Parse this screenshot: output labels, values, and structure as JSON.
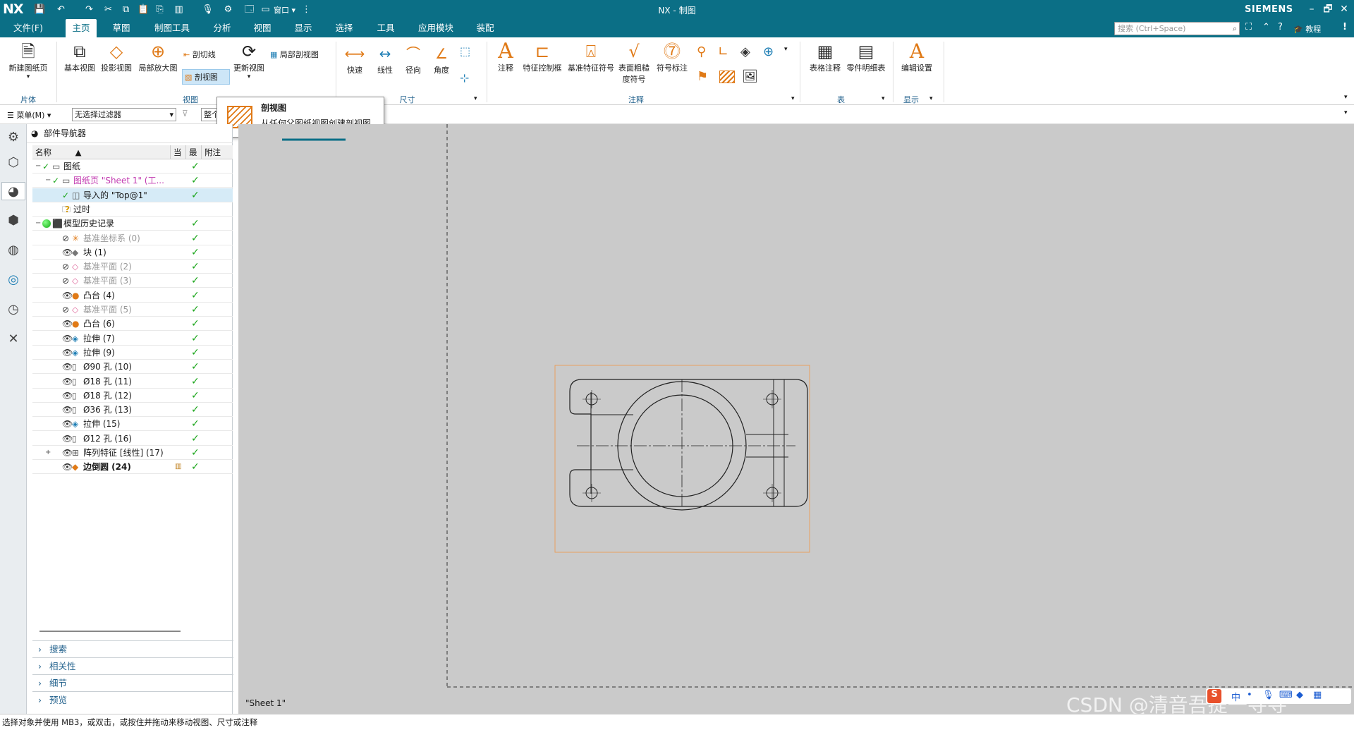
{
  "titlebar": {
    "logo": "NX",
    "title": "NX - 制图",
    "brand": "SIEMENS",
    "window_label": "窗口",
    "window_arrow": "▾",
    "minimize": "–",
    "restore": "🗗",
    "close": "✕"
  },
  "menubar": {
    "file": "文件(F)",
    "tabs": [
      "主页",
      "草图",
      "制图工具",
      "分析",
      "视图",
      "显示",
      "选择",
      "工具",
      "应用模块",
      "装配"
    ],
    "active_tab": "主页",
    "search_placeholder": "搜索 (Ctrl+Space)",
    "tutorial": "教程",
    "info": "!"
  },
  "ribbon": {
    "new_sheet": "新建图纸页",
    "base_view": "基本视图",
    "projected_view": "投影视图",
    "detail_view": "局部放大图",
    "section_line": "剖切线",
    "section_view": "剖视图",
    "update_view": "更新视图",
    "break_out": "局部剖视图",
    "rapid": "快速",
    "linear": "线性",
    "radial": "径向",
    "angular": "角度",
    "note": "注释",
    "fcf": "特征控制框",
    "datum_symbol": "基准特征符号",
    "surface_finish_1": "表面粗糙",
    "surface_finish_2": "度符号",
    "id_symbol": "符号标注",
    "tabular_note": "表格注释",
    "parts_list": "零件明细表",
    "edit_settings": "编辑设置",
    "group_sheet": "片体",
    "group_view": "视图",
    "group_dim": "尺寸",
    "group_annot": "注释",
    "group_table": "表",
    "group_display": "显示"
  },
  "tooltip": {
    "title": "剖视图",
    "desc": "从任何父图纸视图创建剖视图。"
  },
  "toolbar2": {
    "menu": "菜单(M)",
    "filter": "无选择过滤器",
    "scope": "整个"
  },
  "navigator": {
    "title": "部件导航器",
    "col_name": "名称",
    "col_current": "当",
    "col_latest": "最",
    "col_comment": "附注",
    "rows": [
      {
        "label": "图纸",
        "indent": 0
      },
      {
        "label": "图纸页 \"Sheet 1\" (工...",
        "indent": 1
      },
      {
        "label": "导入的 \"Top@1\"",
        "indent": 2
      },
      {
        "label": "过时",
        "indent": 1
      },
      {
        "label": "模型历史记录",
        "indent": 0
      },
      {
        "label": "基准坐标系 (0)",
        "indent": 1
      },
      {
        "label": "块 (1)",
        "indent": 1
      },
      {
        "label": "基准平面 (2)",
        "indent": 1
      },
      {
        "label": "基准平面 (3)",
        "indent": 1
      },
      {
        "label": "凸台 (4)",
        "indent": 1
      },
      {
        "label": "基准平面 (5)",
        "indent": 1
      },
      {
        "label": "凸台 (6)",
        "indent": 1
      },
      {
        "label": "拉伸 (7)",
        "indent": 1
      },
      {
        "label": "拉伸 (9)",
        "indent": 1
      },
      {
        "label": "Ø90 孔 (10)",
        "indent": 1
      },
      {
        "label": "Ø18 孔 (11)",
        "indent": 1
      },
      {
        "label": "Ø18 孔 (12)",
        "indent": 1
      },
      {
        "label": "Ø36 孔 (13)",
        "indent": 1
      },
      {
        "label": "拉伸 (15)",
        "indent": 1
      },
      {
        "label": "Ø12 孔 (16)",
        "indent": 1
      },
      {
        "label": "阵列特征 [线性] (17)",
        "indent": 1
      },
      {
        "label": "边倒圆 (24)",
        "indent": 1
      }
    ],
    "accordion": [
      "搜索",
      "相关性",
      "细节",
      "预览"
    ]
  },
  "canvas": {
    "sheet_label": "\"Sheet 1\""
  },
  "status": "选择对象并使用 MB3，或双击，或按住并拖动来移动视图、尺寸或注释",
  "watermark": "CSDN @清音吾提一寻寻",
  "ime": {
    "lang": "中"
  },
  "colors": {
    "accent": "#0b6f86",
    "canvas": "#cacaca",
    "check": "#19a519",
    "view_border": "#e8a060"
  }
}
